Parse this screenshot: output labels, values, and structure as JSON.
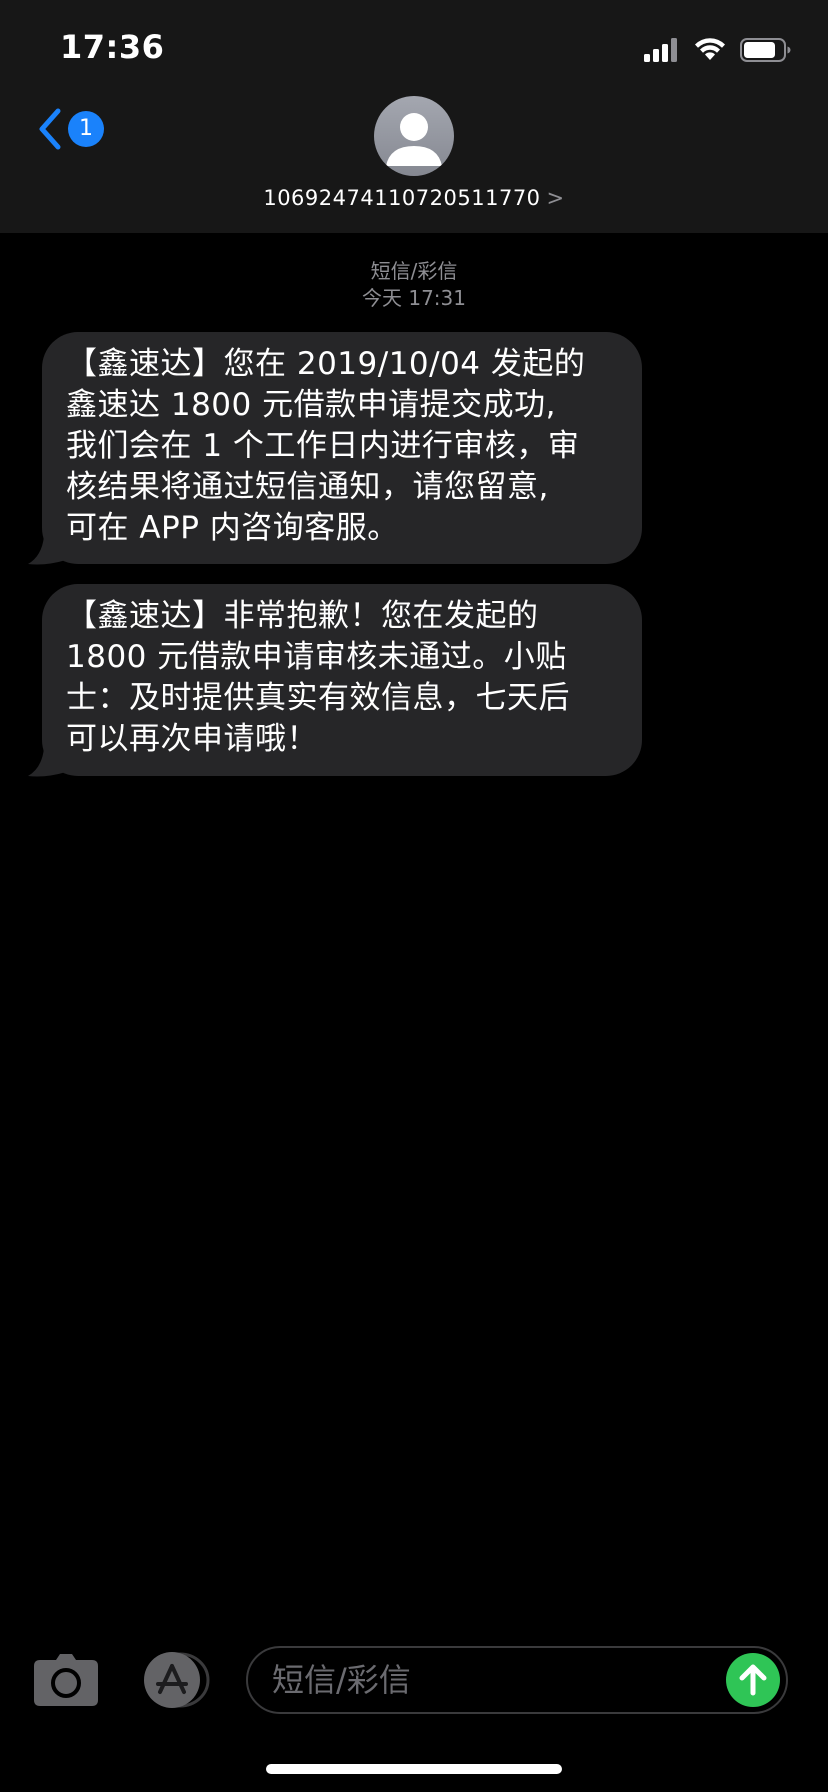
{
  "status_bar": {
    "time": "17:36",
    "icons": [
      "cellular-signal-icon",
      "wifi-icon",
      "battery-icon"
    ]
  },
  "nav": {
    "back_icon": "chevron-left-icon",
    "unread_count": "1",
    "avatar_icon": "person-icon",
    "contact": "1069247411072051177​0",
    "contact_chevron": ">"
  },
  "thread": {
    "service": "短信/彩信",
    "timestamp": "今天 17:31",
    "messages": [
      {
        "lines": [
          "【鑫速达】您在 2019/10/04 发起的",
          "鑫速达 1800 元借款申请提交成功,",
          "我们会在 1 个工作日内进行审核，审",
          "核结果将通过短信通知，请您留意,",
          "可在 APP 内咨询客服。"
        ]
      },
      {
        "lines": [
          "【鑫速达】非常抱歉！您在发起的",
          "1800 元借款申请审核未通过。小贴",
          "士：及时提供真实有效信息，七天后",
          "可以再次申请哦！"
        ]
      }
    ]
  },
  "compose": {
    "placeholder": "短信/彩信",
    "camera_icon": "camera-icon",
    "appstore_icon": "app-store-icon",
    "send_icon": "arrow-up-icon"
  },
  "colors": {
    "accent_blue": "#1a82fb",
    "bubble_gray": "#262628",
    "send_green": "#2fc556",
    "header_bg": "#171717"
  }
}
